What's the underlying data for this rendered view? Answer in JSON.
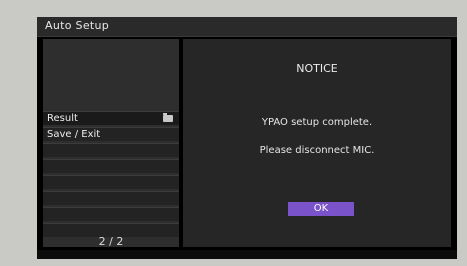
{
  "window": {
    "title": "Auto Setup"
  },
  "sidebar": {
    "items": [
      {
        "label": "Result",
        "icon": "folder-icon"
      },
      {
        "label": "Save / Exit"
      },
      {
        "label": ""
      },
      {
        "label": ""
      },
      {
        "label": ""
      },
      {
        "label": ""
      },
      {
        "label": ""
      },
      {
        "label": ""
      }
    ],
    "page": "2 / 2"
  },
  "dialog": {
    "heading": "NOTICE",
    "message_line1": "YPAO setup complete.",
    "message_line2": "Please disconnect MIC.",
    "ok_label": "OK"
  },
  "colors": {
    "accent": "#7a52c9",
    "background": "#000000",
    "panel": "#2e2e2e"
  }
}
